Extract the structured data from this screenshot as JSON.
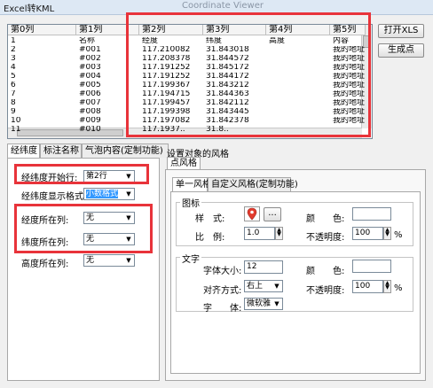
{
  "window": {
    "title": "Excel转KML",
    "ghost_title": "Coordinate Viewer"
  },
  "grid": {
    "headers": [
      "第0列",
      "第1列",
      "第2列",
      "第3列",
      "第4列",
      "第5列"
    ],
    "rows": [
      [
        "1",
        "名称",
        "经度",
        "纬度",
        "高度",
        "内容"
      ],
      [
        "2",
        "#001",
        "117.210082",
        "31.843018",
        "",
        "我的地址"
      ],
      [
        "3",
        "#002",
        "117.208378",
        "31.844572",
        "",
        "我的地址"
      ],
      [
        "4",
        "#003",
        "117.191252",
        "31.845172",
        "",
        "我的地址"
      ],
      [
        "5",
        "#004",
        "117.191252",
        "31.844172",
        "",
        "我的地址"
      ],
      [
        "6",
        "#005",
        "117.199367",
        "31.843212",
        "",
        "我的地址"
      ],
      [
        "7",
        "#006",
        "117.194715",
        "31.844363",
        "",
        "我的地址"
      ],
      [
        "8",
        "#007",
        "117.199457",
        "31.842112",
        "",
        "我的地址"
      ],
      [
        "9",
        "#008",
        "117.199398",
        "31.843445",
        "",
        "我的地址"
      ],
      [
        "10",
        "#009",
        "117.197082",
        "31.842378",
        "",
        "我的地址"
      ],
      [
        "11",
        "#010",
        "117.1937..",
        "31.8..",
        "",
        ""
      ]
    ]
  },
  "buttons": {
    "open_xls": "打开XLS",
    "gen_points": "生成点"
  },
  "left_tabs": [
    "经纬度",
    "标注名称",
    "气泡内容(定制功能)"
  ],
  "left_panel": {
    "start_row_label": "经纬度开始行:",
    "start_row_value": "第2行",
    "format_label": "经纬度显示格式:",
    "format_value": "小数格式",
    "lon_col_label": "经度所在列:",
    "lon_col_value": "无",
    "lat_col_label": "纬度所在列:",
    "lat_col_value": "无",
    "alt_col_label": "高度所在列:",
    "alt_col_value": "无"
  },
  "right": {
    "header": "设置对象的风格",
    "outer_tab": "点风格",
    "inner_tabs": [
      "单一风格",
      "自定义风格(定制功能)"
    ],
    "icon_group": {
      "title": "图标",
      "style_label": "样　式:",
      "color_label": "颜　　色:",
      "scale_label": "比　例:",
      "scale_value": "1.0",
      "opacity_label": "不透明度:",
      "opacity_value": "100",
      "opacity_unit": "%",
      "more_btn": "..."
    },
    "text_group": {
      "title": "文字",
      "size_label": "字体大小:",
      "size_value": "12",
      "color_label": "颜　　色:",
      "align_label": "对齐方式:",
      "align_value": "右上",
      "opacity_label": "不透明度:",
      "opacity_value": "100",
      "opacity_unit": "%",
      "font_label": "字　　体:",
      "font_value": "微软雅"
    }
  },
  "colors": {
    "highlight": "#e8333a",
    "selection": "#3399ff"
  },
  "icons": [
    "map-pin-icon",
    "dropdown-arrow-icon",
    "spin-up-icon",
    "spin-down-icon"
  ]
}
